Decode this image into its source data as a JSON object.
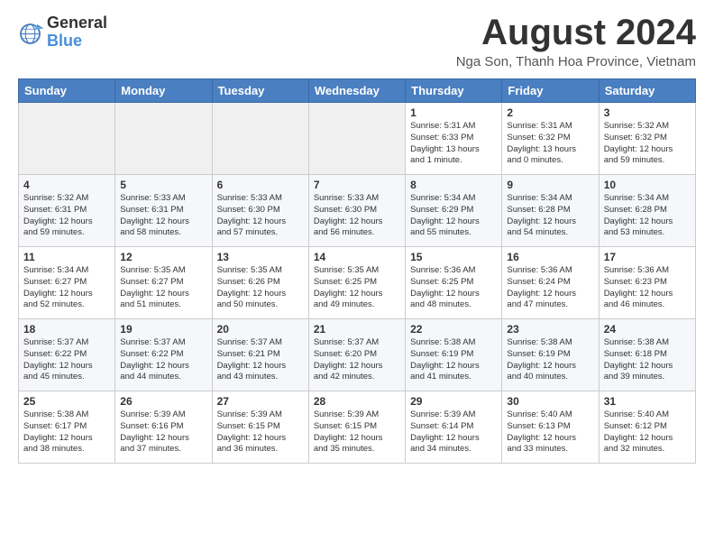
{
  "logo": {
    "line1": "General",
    "line2": "Blue"
  },
  "title": "August 2024",
  "location": "Nga Son, Thanh Hoa Province, Vietnam",
  "days_header": [
    "Sunday",
    "Monday",
    "Tuesday",
    "Wednesday",
    "Thursday",
    "Friday",
    "Saturday"
  ],
  "weeks": [
    [
      {
        "day": "",
        "info": ""
      },
      {
        "day": "",
        "info": ""
      },
      {
        "day": "",
        "info": ""
      },
      {
        "day": "",
        "info": ""
      },
      {
        "day": "1",
        "info": "Sunrise: 5:31 AM\nSunset: 6:33 PM\nDaylight: 13 hours\nand 1 minute."
      },
      {
        "day": "2",
        "info": "Sunrise: 5:31 AM\nSunset: 6:32 PM\nDaylight: 13 hours\nand 0 minutes."
      },
      {
        "day": "3",
        "info": "Sunrise: 5:32 AM\nSunset: 6:32 PM\nDaylight: 12 hours\nand 59 minutes."
      }
    ],
    [
      {
        "day": "4",
        "info": "Sunrise: 5:32 AM\nSunset: 6:31 PM\nDaylight: 12 hours\nand 59 minutes."
      },
      {
        "day": "5",
        "info": "Sunrise: 5:33 AM\nSunset: 6:31 PM\nDaylight: 12 hours\nand 58 minutes."
      },
      {
        "day": "6",
        "info": "Sunrise: 5:33 AM\nSunset: 6:30 PM\nDaylight: 12 hours\nand 57 minutes."
      },
      {
        "day": "7",
        "info": "Sunrise: 5:33 AM\nSunset: 6:30 PM\nDaylight: 12 hours\nand 56 minutes."
      },
      {
        "day": "8",
        "info": "Sunrise: 5:34 AM\nSunset: 6:29 PM\nDaylight: 12 hours\nand 55 minutes."
      },
      {
        "day": "9",
        "info": "Sunrise: 5:34 AM\nSunset: 6:28 PM\nDaylight: 12 hours\nand 54 minutes."
      },
      {
        "day": "10",
        "info": "Sunrise: 5:34 AM\nSunset: 6:28 PM\nDaylight: 12 hours\nand 53 minutes."
      }
    ],
    [
      {
        "day": "11",
        "info": "Sunrise: 5:34 AM\nSunset: 6:27 PM\nDaylight: 12 hours\nand 52 minutes."
      },
      {
        "day": "12",
        "info": "Sunrise: 5:35 AM\nSunset: 6:27 PM\nDaylight: 12 hours\nand 51 minutes."
      },
      {
        "day": "13",
        "info": "Sunrise: 5:35 AM\nSunset: 6:26 PM\nDaylight: 12 hours\nand 50 minutes."
      },
      {
        "day": "14",
        "info": "Sunrise: 5:35 AM\nSunset: 6:25 PM\nDaylight: 12 hours\nand 49 minutes."
      },
      {
        "day": "15",
        "info": "Sunrise: 5:36 AM\nSunset: 6:25 PM\nDaylight: 12 hours\nand 48 minutes."
      },
      {
        "day": "16",
        "info": "Sunrise: 5:36 AM\nSunset: 6:24 PM\nDaylight: 12 hours\nand 47 minutes."
      },
      {
        "day": "17",
        "info": "Sunrise: 5:36 AM\nSunset: 6:23 PM\nDaylight: 12 hours\nand 46 minutes."
      }
    ],
    [
      {
        "day": "18",
        "info": "Sunrise: 5:37 AM\nSunset: 6:22 PM\nDaylight: 12 hours\nand 45 minutes."
      },
      {
        "day": "19",
        "info": "Sunrise: 5:37 AM\nSunset: 6:22 PM\nDaylight: 12 hours\nand 44 minutes."
      },
      {
        "day": "20",
        "info": "Sunrise: 5:37 AM\nSunset: 6:21 PM\nDaylight: 12 hours\nand 43 minutes."
      },
      {
        "day": "21",
        "info": "Sunrise: 5:37 AM\nSunset: 6:20 PM\nDaylight: 12 hours\nand 42 minutes."
      },
      {
        "day": "22",
        "info": "Sunrise: 5:38 AM\nSunset: 6:19 PM\nDaylight: 12 hours\nand 41 minutes."
      },
      {
        "day": "23",
        "info": "Sunrise: 5:38 AM\nSunset: 6:19 PM\nDaylight: 12 hours\nand 40 minutes."
      },
      {
        "day": "24",
        "info": "Sunrise: 5:38 AM\nSunset: 6:18 PM\nDaylight: 12 hours\nand 39 minutes."
      }
    ],
    [
      {
        "day": "25",
        "info": "Sunrise: 5:38 AM\nSunset: 6:17 PM\nDaylight: 12 hours\nand 38 minutes."
      },
      {
        "day": "26",
        "info": "Sunrise: 5:39 AM\nSunset: 6:16 PM\nDaylight: 12 hours\nand 37 minutes."
      },
      {
        "day": "27",
        "info": "Sunrise: 5:39 AM\nSunset: 6:15 PM\nDaylight: 12 hours\nand 36 minutes."
      },
      {
        "day": "28",
        "info": "Sunrise: 5:39 AM\nSunset: 6:15 PM\nDaylight: 12 hours\nand 35 minutes."
      },
      {
        "day": "29",
        "info": "Sunrise: 5:39 AM\nSunset: 6:14 PM\nDaylight: 12 hours\nand 34 minutes."
      },
      {
        "day": "30",
        "info": "Sunrise: 5:40 AM\nSunset: 6:13 PM\nDaylight: 12 hours\nand 33 minutes."
      },
      {
        "day": "31",
        "info": "Sunrise: 5:40 AM\nSunset: 6:12 PM\nDaylight: 12 hours\nand 32 minutes."
      }
    ]
  ]
}
